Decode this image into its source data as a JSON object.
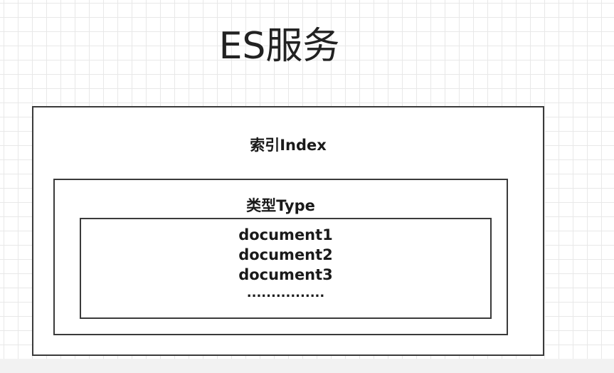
{
  "title": "ES服务",
  "index": {
    "label": "索引Index",
    "type": {
      "label": "类型Type",
      "documents": [
        "document1",
        "document2",
        "document3"
      ],
      "ellipsis": "................"
    }
  },
  "colors": {
    "border": "#3a3a3a",
    "text": "#1a1a1a",
    "grid": "#e8e8e8",
    "background": "#ffffff"
  }
}
